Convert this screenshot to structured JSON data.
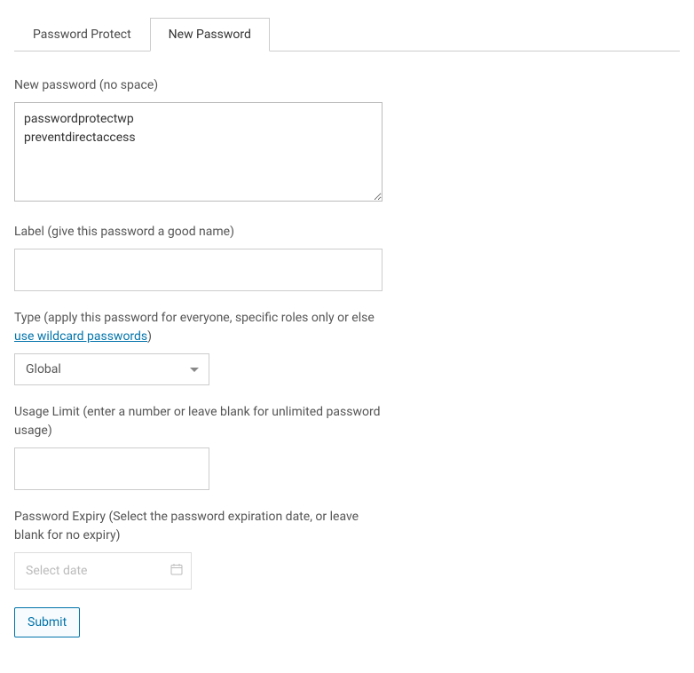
{
  "tabs": {
    "password_protect": "Password Protect",
    "new_password": "New Password"
  },
  "form": {
    "new_password": {
      "label": "New password (no space)",
      "value": "passwordprotectwp\npreventdirectaccess"
    },
    "label_field": {
      "label": "Label (give this password a good name)",
      "value": ""
    },
    "type_field": {
      "label_prefix": "Type (apply this password for everyone, specific roles only or else ",
      "link_text": "use wildcard passwords",
      "label_suffix": ")",
      "selected": "Global"
    },
    "usage_limit": {
      "label": "Usage Limit (enter a number or leave blank for unlimited password usage)",
      "value": ""
    },
    "expiry": {
      "label": "Password Expiry (Select the password expiration date, or leave blank for no expiry)",
      "placeholder": "Select date",
      "value": ""
    },
    "submit": "Submit"
  }
}
